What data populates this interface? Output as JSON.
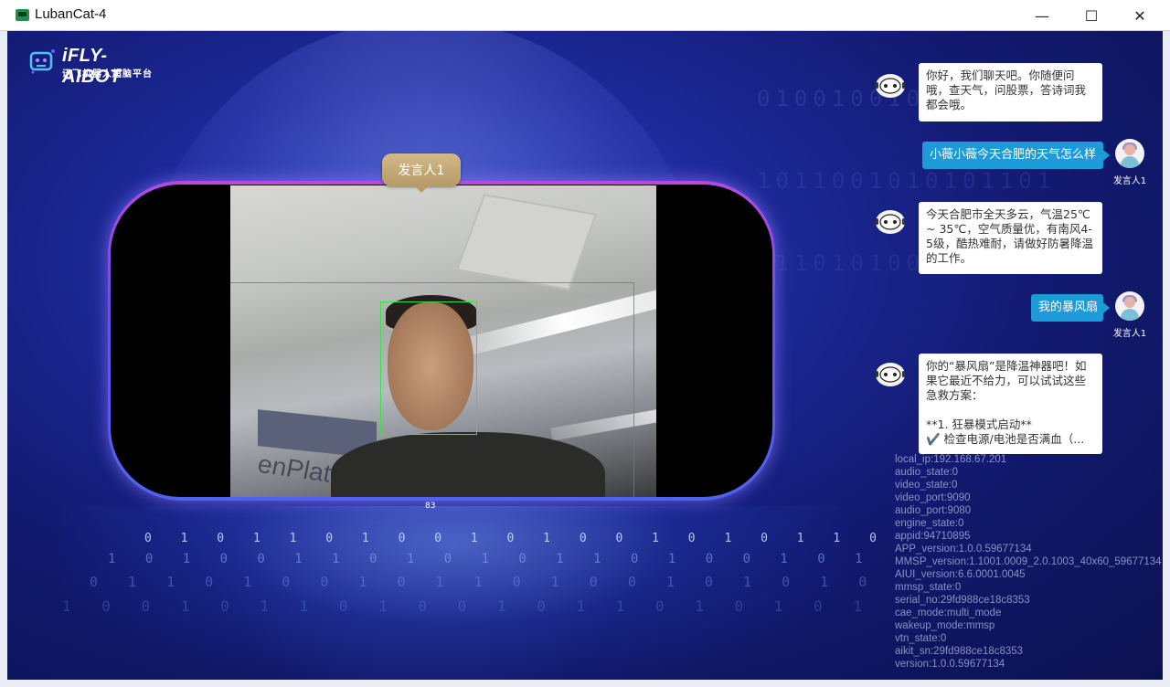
{
  "window": {
    "title": "LubanCat-4",
    "minimize_glyph": "—",
    "maximize_glyph": "☐",
    "close_glyph": "✕"
  },
  "logo": {
    "title": "iFLY-AIBOT",
    "subtitle": "讯飞机器人超脑平台"
  },
  "video": {
    "speaker_tag": "发言人1",
    "score": "83"
  },
  "chat": {
    "messages": [
      {
        "from": "robot",
        "text": "你好，我们聊天吧。你随便问哦，查天气，问股票，答诗词我都会哦。"
      },
      {
        "from": "user",
        "text": "小薇小薇今天合肥的天气怎么样",
        "user_label": "发言人1"
      },
      {
        "from": "robot",
        "text": "今天合肥市全天多云，气温25℃ ~ 35℃，空气质量优，有南风4-5级，酷热难耐，请做好防暑降温的工作。"
      },
      {
        "from": "user",
        "text": "我的暴风扇",
        "user_label": "发言人1"
      },
      {
        "from": "robot",
        "text": "你的“暴风扇”是降温神器吧！如果它最近不给力，可以试试这些急救方案：\n\n**1. 狂暴模式启动**\n✔️ 检查电源/电池是否满血（..."
      }
    ]
  },
  "status_lines": [
    "local_ip:192.168.67.201",
    "audio_state:0",
    "video_state:0",
    "video_port:9090",
    "audio_port:9080",
    "engine_state:0",
    "appid:94710895",
    "APP_version:1.0.0.59677134",
    "MMSP_version:1.1001.0009_2.0.1003_40x60_59677134",
    "AIUI_version:6.6.0001.0045",
    "mmsp_state:0",
    "serial_no:29fd988ce18c8353",
    "cae_mode:multi_mode",
    "wakeup_mode:mmsp",
    "vtn_state:0",
    "aikit_sn:29fd988ce18c8353",
    "version:1.0.0.59677134"
  ],
  "colors": {
    "user_bubble": "#1c9bd8",
    "detect_box": "#39e04c",
    "speaker_tag": "#c2a676"
  }
}
